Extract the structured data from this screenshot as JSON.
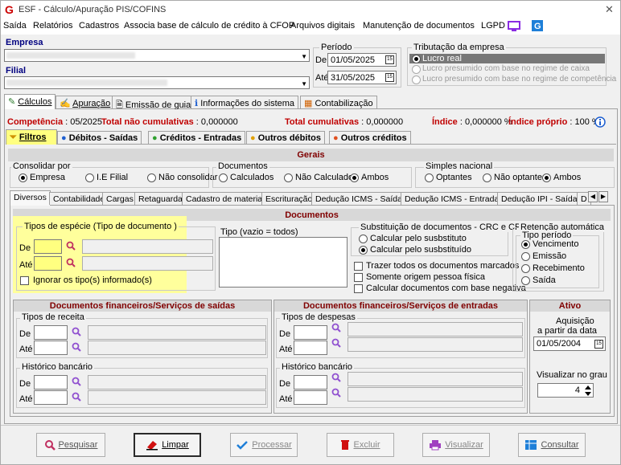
{
  "window": {
    "title": "ESF - Cálculo/Apuração PIS/COFINS",
    "close": "✕"
  },
  "menu": [
    "Saída",
    "Relatórios",
    "Cadastros",
    "Associa base de cálculo de crédito à CFOP",
    "Arquivos digitais",
    "Manutenção de documentos",
    "LGPD"
  ],
  "empresa": {
    "label": "Empresa",
    "label2": "Filial"
  },
  "periodo": {
    "title": "Período",
    "de_label": "De",
    "de": "01/05/2025",
    "ate_label": "Até",
    "ate": "31/05/2025"
  },
  "tributacao": {
    "title": "Tributação da empresa",
    "options": [
      "Lucro real",
      "Lucro presumido com base no regime de caixa",
      "Lucro presumido com base no regime de competência"
    ]
  },
  "main_tabs": [
    "Cálculos",
    "Apuração",
    "Emissão de guias",
    "Informações do sistema",
    "Contabilização"
  ],
  "status": {
    "competencia": "Competência : 05/2025",
    "nao_cum": "Total não cumulativas : 0,000000",
    "cum": "Total cumulativas : 0,000000",
    "indice": "Índice : 0,000000 %",
    "indice_proprio": "Índice próprio : 100 %"
  },
  "sub_tabs": [
    "Filtros",
    "Débitos - Saídas",
    "Créditos - Entradas",
    "Outros débitos",
    "Outros créditos"
  ],
  "gerais": {
    "title": "Gerais",
    "consolidar": {
      "title": "Consolidar por",
      "options": [
        "Empresa",
        "I.E Filial",
        "Não consolidar"
      ]
    },
    "documentos": {
      "title": "Documentos",
      "options": [
        "Calculados",
        "Não Calculados",
        "Ambos"
      ]
    },
    "simples": {
      "title": "Simples nacional",
      "options": [
        "Optantes",
        "Não optantes",
        "Ambos"
      ]
    }
  },
  "inner_tabs": [
    "Diversos",
    "Contabilidade",
    "Cargas",
    "Retaguarda",
    "Cadastro de materiais",
    "Escrituração",
    "Dedução ICMS - Saídas",
    "Dedução ICMS - Entradas",
    "Dedução IPI - Saídas",
    "D"
  ],
  "documentos": {
    "title": "Documentos",
    "especie_title": "Tipos de espécie (Tipo de documento )",
    "de": "De",
    "ate": "Até",
    "ignorar": "Ignorar os tipo(s) informado(s)",
    "tipo_title": "Tipo (vazio = todos)",
    "subst_title": "Substituição de documentos  - CRC e CPG",
    "subst_opts": [
      "Calcular pelo susbstituto",
      "Calcular pelo susbstituído"
    ],
    "checks": [
      "Trazer todos os documentos marcados",
      "Somente origem pessoa física",
      "Calcular documentos com base negativa"
    ],
    "retencao_title": "Retenção automática",
    "periodo_title": "Tipo período",
    "periodo_opts": [
      "Vencimento",
      "Emissão",
      "Recebimento",
      "Saída"
    ]
  },
  "fin_saidas": {
    "title": "Documentos financeiros/Serviços de saídas",
    "receita": "Tipos de receita",
    "historico": "Histórico bancário",
    "de": "De",
    "ate": "Até"
  },
  "fin_entradas": {
    "title": "Documentos financeiros/Serviços de entradas",
    "despesas": "Tipos de despesas",
    "historico": "Histórico bancário",
    "de": "De",
    "ate": "Até"
  },
  "ativo": {
    "title": "Ativo",
    "aquisicao": "Aquisição",
    "a_partir": "a partir da data",
    "data": "01/05/2004",
    "grau_label": "Visualizar no grau",
    "grau": "4"
  },
  "buttons": [
    "Pesquisar",
    "Limpar",
    "Processar",
    "Excluir",
    "Visualizar",
    "Consultar"
  ]
}
